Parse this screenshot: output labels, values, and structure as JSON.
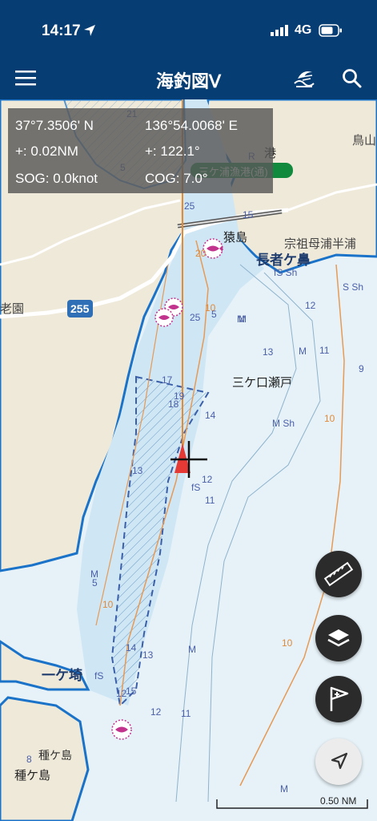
{
  "status": {
    "time": "14:17",
    "network": "4G"
  },
  "nav": {
    "title": "海釣図Ⅴ"
  },
  "info": {
    "latitude": "37°7.3506' N",
    "longitude": "136°54.0068' E",
    "distance": "+: 0.02NM",
    "bearing": "+: 122.1°",
    "sog": "SOG: 0.0knot",
    "cog": "COG: 7.0°"
  },
  "map": {
    "place_labels": [
      "長者ケ鼻",
      "三ケ口瀬戸",
      "一ケ埼",
      "猿島",
      "種ケ島",
      "種ケ島",
      "鳥山",
      "港",
      "宗祖母浦半浦",
      "老園"
    ],
    "port_label": "三ケ浦漁港(通)",
    "route_number": "255",
    "depths": [
      "21",
      "5",
      "25",
      "15",
      "20",
      "25",
      "10",
      "5",
      "M",
      "fS Sh",
      "S Sh",
      "12",
      "13",
      "M",
      "11",
      "9",
      "17",
      "19",
      "18",
      "14",
      "M Sh",
      "10",
      "13",
      "12",
      "fS",
      "11",
      "M",
      "5",
      "10",
      "14",
      "13",
      "fS",
      "12",
      "15",
      "M",
      "12",
      "11",
      "M",
      "8",
      "10",
      "M",
      "R"
    ]
  },
  "scale": {
    "label": "0.50 NM"
  },
  "colors": {
    "nav_bar": "#063d73",
    "land": "#efe9d9",
    "shallow_sea": "#cfe6f5",
    "sea": "#e6f2f8",
    "coastline": "#1a73c8",
    "boat_marker": "#e53935"
  },
  "icons": [
    "location-arrow-icon",
    "menu-icon",
    "tide-icon",
    "search-icon",
    "ruler-icon",
    "layers-icon",
    "add-flag-icon",
    "navigation-icon"
  ]
}
